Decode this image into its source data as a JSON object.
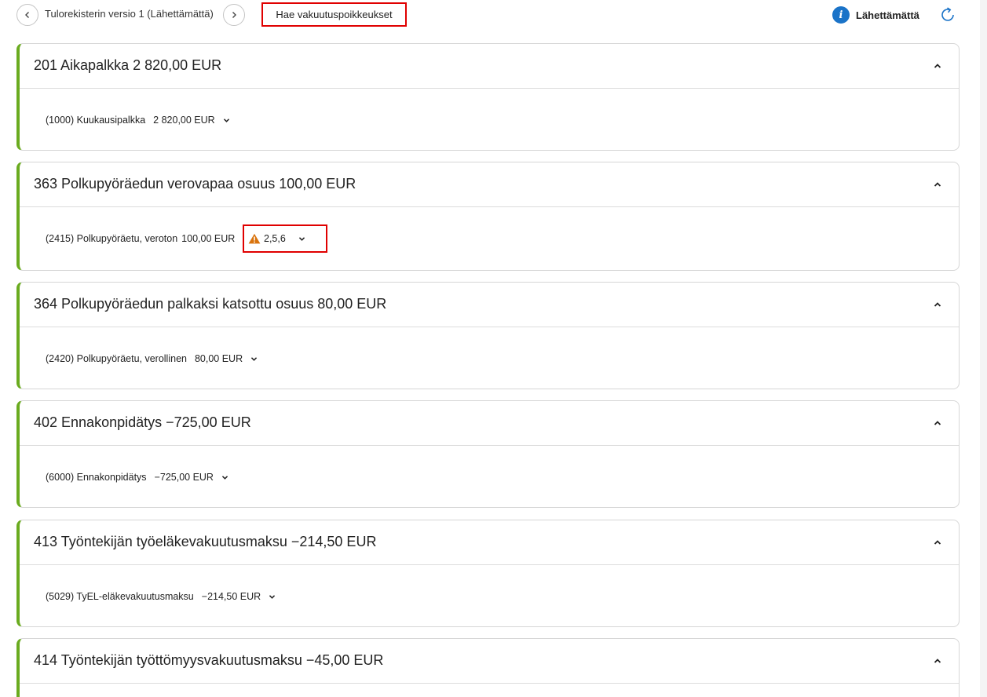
{
  "header": {
    "version_title": "Tulorekisterin versio 1 (Lähettämättä)",
    "fetch_button": "Hae vakuutuspoikkeukset",
    "status_text": "Lähettämättä",
    "info_icon_glyph": "i"
  },
  "colors": {
    "accent_green": "#6aab1f",
    "highlight_red": "#e00000",
    "info_blue": "#1a73c8",
    "warning_orange": "#d9730d"
  },
  "cards": [
    {
      "title": "201 Aikapalkka 2 820,00 EUR",
      "item_label": "(1000) Kuukausipalkka",
      "item_amount": "2 820,00 EUR"
    },
    {
      "title": "363 Polkupyöräedun verovapaa osuus 100,00 EUR",
      "item_label": "(2415) Polkupyöräetu, veroton",
      "item_amount": "100,00 EUR",
      "warning": "2,5,6"
    },
    {
      "title": "364 Polkupyöräedun palkaksi katsottu osuus 80,00 EUR",
      "item_label": "(2420) Polkupyöräetu, verollinen",
      "item_amount": "80,00 EUR"
    },
    {
      "title": "402 Ennakonpidätys −725,00 EUR",
      "item_label": "(6000) Ennakonpidätys",
      "item_amount": "−725,00 EUR"
    },
    {
      "title": "413 Työntekijän työeläkevakuutusmaksu −214,50 EUR",
      "item_label": "(5029) TyEL-eläkevakuutusmaksu",
      "item_amount": "−214,50 EUR"
    },
    {
      "title": "414 Työntekijän työttömyysvakuutusmaksu −45,00 EUR"
    }
  ]
}
